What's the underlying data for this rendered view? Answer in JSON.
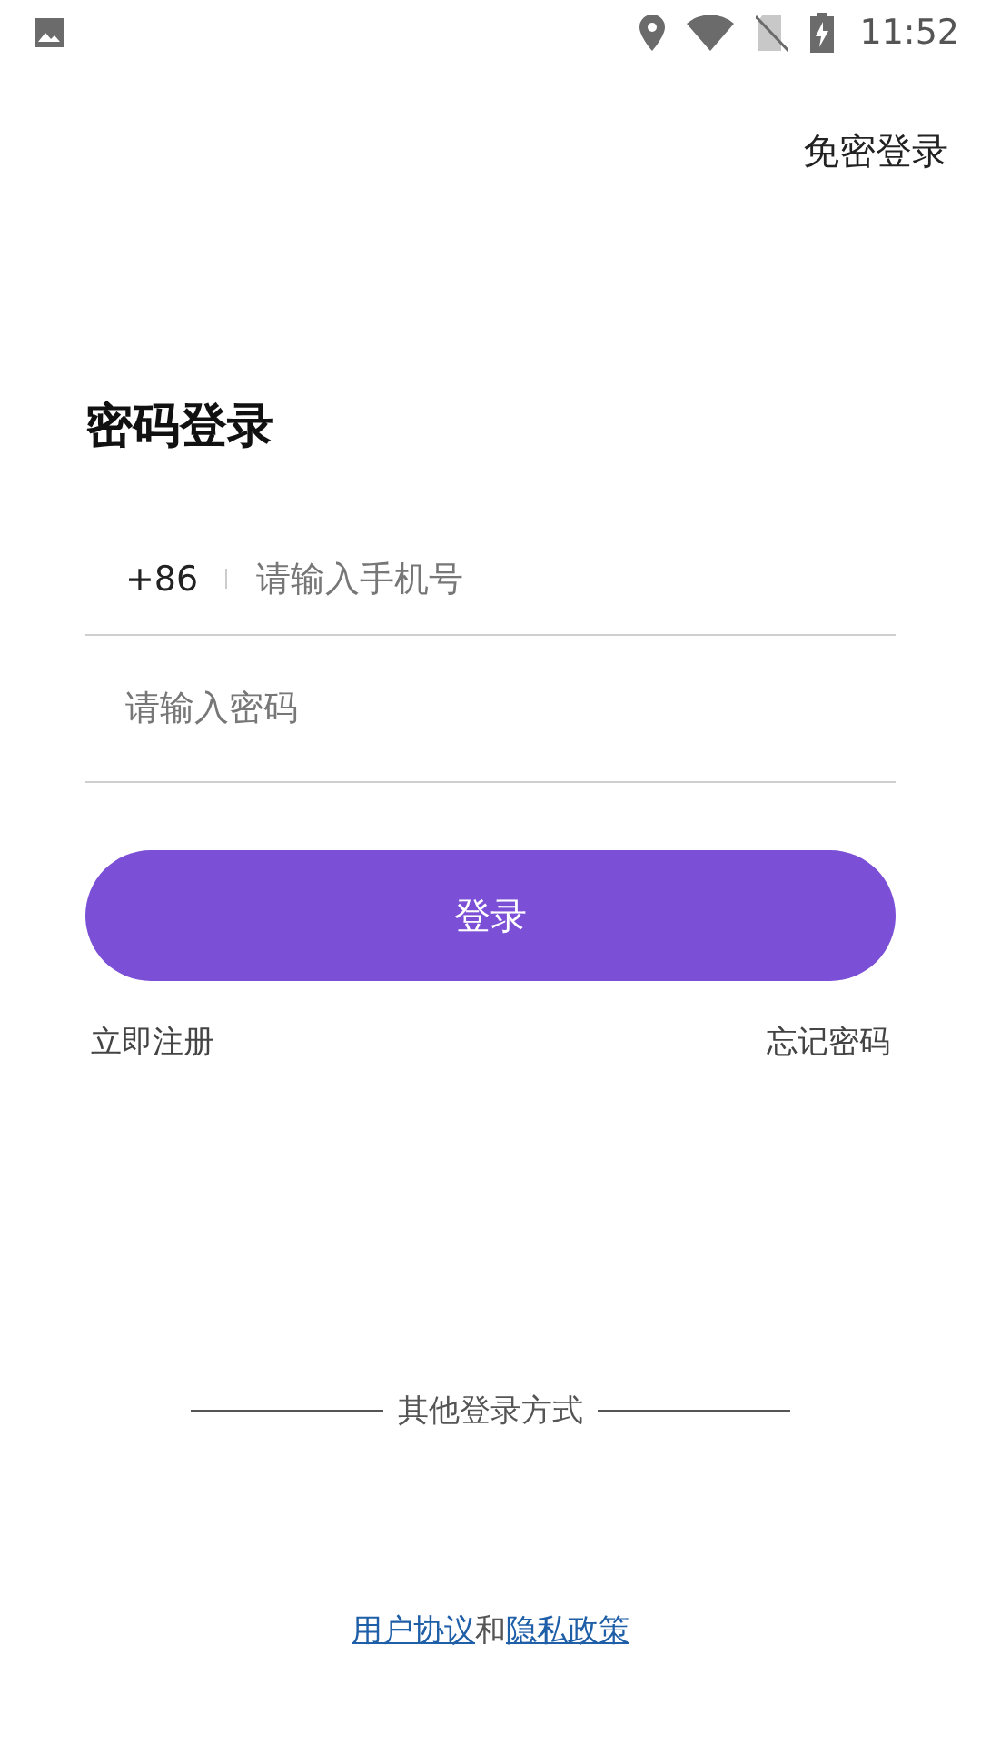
{
  "status_bar": {
    "time": "11:52"
  },
  "top_action": "免密登录",
  "title": "密码登录",
  "phone": {
    "country_code": "+86",
    "placeholder": "请输入手机号"
  },
  "password": {
    "placeholder": "请输入密码"
  },
  "login_button": "登录",
  "links": [
    "立即注册",
    "忘记密码"
  ],
  "other_login": "其他登录方式",
  "agreement": [
    {
      "kind": "link",
      "text": "用户协议"
    },
    {
      "kind": "plain",
      "text": "和"
    },
    {
      "kind": "link",
      "text": "隐私政策"
    }
  ]
}
